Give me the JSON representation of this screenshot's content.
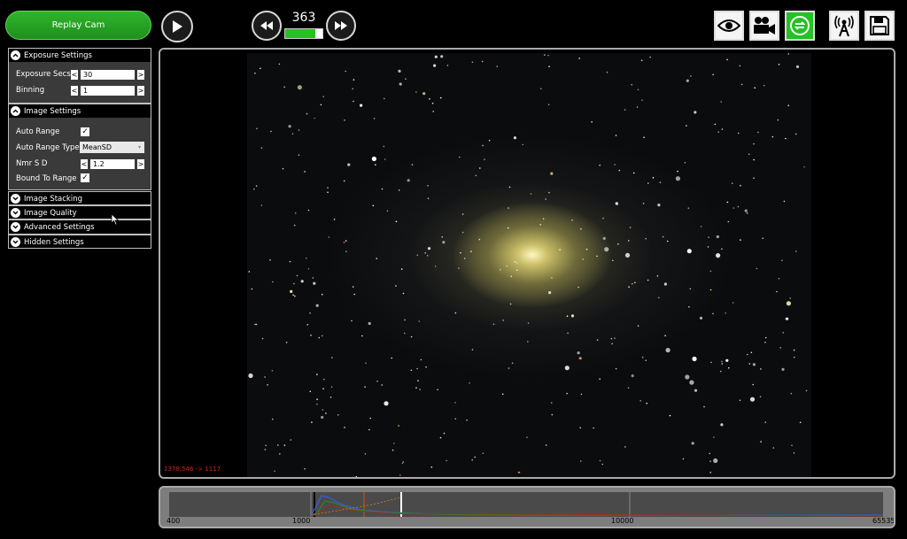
{
  "toolbar": {
    "cam_label": "Replay Cam",
    "frame_number": "363",
    "frame_progress": 0.82,
    "tools": [
      {
        "name": "eye-icon"
      },
      {
        "name": "video-camera-icon"
      },
      {
        "name": "loop-icon",
        "active": true
      },
      {
        "name": "broadcast-icon"
      },
      {
        "name": "save-icon"
      }
    ]
  },
  "sidebar": {
    "exposure": {
      "title": "Exposure Settings",
      "secs_label": "Exposure Secs",
      "secs_value": "30",
      "binning_label": "Binning",
      "binning_value": "1"
    },
    "image": {
      "title": "Image Settings",
      "auto_range_label": "Auto Range",
      "auto_range_type_label": "Auto Range Type",
      "auto_range_type_value": "MeanSD",
      "nmr_sd_label": "Nmr S D",
      "nmr_sd_value": "1.2",
      "bound_label": "Bound To Range"
    },
    "collapsed": [
      "Image Stacking",
      "Image Quality",
      "Advanced Settings",
      "Hidden Settings"
    ]
  },
  "viewer": {
    "coord_text": "1378,546 -> 1117"
  },
  "histogram": {
    "labels": [
      "400",
      "1000",
      "10000",
      "65535"
    ]
  },
  "colors": {
    "accent_green": "#22c322",
    "panel_border": "#aaaaaa"
  }
}
